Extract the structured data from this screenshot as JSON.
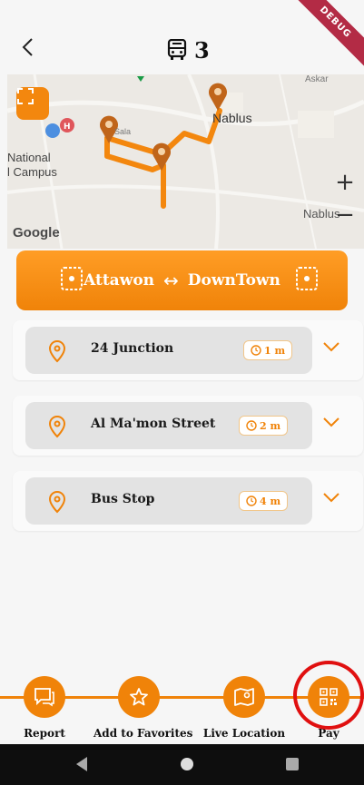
{
  "header": {
    "back_icon": "chevron-left-icon",
    "title_icon": "bus-icon",
    "title": "3",
    "debug_badge": "DEBUG"
  },
  "map": {
    "label_nablus_1": "Nablus",
    "label_askar": "Askar",
    "label_sala": "Sala",
    "label_national_1": "National",
    "label_national_2": "l Campus",
    "label_nablus_2": "Nablus",
    "google_label": "Google",
    "zoom_in": "+",
    "zoom_out": "−"
  },
  "route": {
    "from": "Attawon",
    "arrow": "↔",
    "to": "DownTown"
  },
  "stops": [
    {
      "name": "24 Junction",
      "time": "1 m"
    },
    {
      "name": "Al Ma'mon Street",
      "time": "2 m"
    },
    {
      "name": "Bus Stop",
      "time": "4 m"
    }
  ],
  "bottom_nav": [
    {
      "label": "Report",
      "icon": "report-icon"
    },
    {
      "label": "Add to Favorites",
      "icon": "star-icon"
    },
    {
      "label": "Live Location",
      "icon": "map-icon"
    },
    {
      "label": "Pay",
      "icon": "qr-code-icon"
    }
  ],
  "colors": {
    "accent": "#f08309",
    "highlight_ring": "#e01010"
  }
}
